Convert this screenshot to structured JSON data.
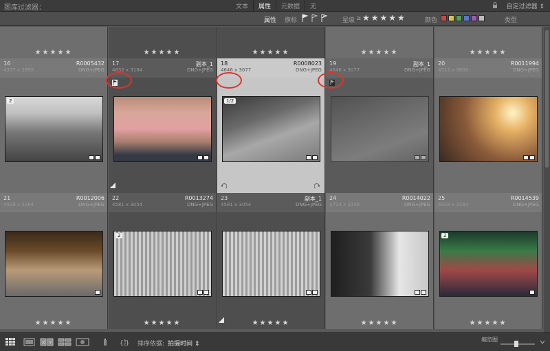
{
  "filter_bar": {
    "title": "图库过滤器：",
    "tabs": [
      {
        "label": "文本",
        "active": false
      },
      {
        "label": "属性",
        "active": true
      },
      {
        "label": "元数据",
        "active": false
      },
      {
        "label": "无",
        "active": false
      }
    ],
    "custom_filter": "自定过滤器 ⇕"
  },
  "attr_bar": {
    "attr_label": "属性",
    "flag_label": "旗标",
    "rating_label": "星级",
    "rating_op": "≥",
    "rating_stars": "★★★★★",
    "color_label": "颜色",
    "type_label": "类型",
    "swatch_colors": [
      "#c44848",
      "#d8c44a",
      "#56a056",
      "#5a78c8",
      "#9a5ab0",
      "#bdbdbd"
    ]
  },
  "cells": [
    {
      "idx": "16",
      "name": "R0005432",
      "dims": "4337 x 2895",
      "fmt": "DNG+JPEG",
      "stars": "★★★★★",
      "top_stars": "★★★★★",
      "badge": "2"
    },
    {
      "idx": "17",
      "name": "副本_1",
      "dims": "4632 x 3184",
      "fmt": "DNG+JPEG",
      "stars": "★★★★★",
      "top_stars": "★★★★★",
      "badge": ""
    },
    {
      "idx": "18",
      "name": "R0008023",
      "dims": "4646 x 3077",
      "fmt": "DNG+JPEG",
      "stars": "★★★★★",
      "top_stars": "★★★★★",
      "badge": "1/2"
    },
    {
      "idx": "19",
      "name": "副本_1",
      "dims": "4646 x 3077",
      "fmt": "DNG+JPEG",
      "stars": "★★★★★",
      "top_stars": "★★★★★",
      "badge": ""
    },
    {
      "idx": "20",
      "name": "R0011994",
      "dims": "4512 x 3008",
      "fmt": "DNG+JPEG",
      "stars": "★★★★★",
      "top_stars": "★★★★★",
      "badge": ""
    },
    {
      "idx": "21",
      "name": "R0012006",
      "dims": "4928 x 3264",
      "fmt": "DNG+JPEG",
      "stars": "★★★★★",
      "top_stars": "",
      "badge": ""
    },
    {
      "idx": "22",
      "name": "R0013274",
      "dims": "4581 x 3054",
      "fmt": "DNG+JPEG",
      "stars": "★★★★★",
      "top_stars": "",
      "badge": "2"
    },
    {
      "idx": "23",
      "name": "副本_1",
      "dims": "4581 x 3054",
      "fmt": "DNG+JPEG",
      "stars": "★★★★★",
      "top_stars": "",
      "badge": ""
    },
    {
      "idx": "24",
      "name": "R0014022",
      "dims": "4724 x 3156",
      "fmt": "DNG+JPEG",
      "stars": "★★★★★",
      "top_stars": "",
      "badge": ""
    },
    {
      "idx": "25",
      "name": "R0014539",
      "dims": "4928 x 3264",
      "fmt": "DNG+JPEG",
      "stars": "★★★★★",
      "top_stars": "",
      "badge": "2"
    }
  ],
  "toolbar": {
    "sort_label": "排序依据:",
    "sort_value": "拍摄时间 ⇕",
    "thumb_label": "缩览图"
  }
}
